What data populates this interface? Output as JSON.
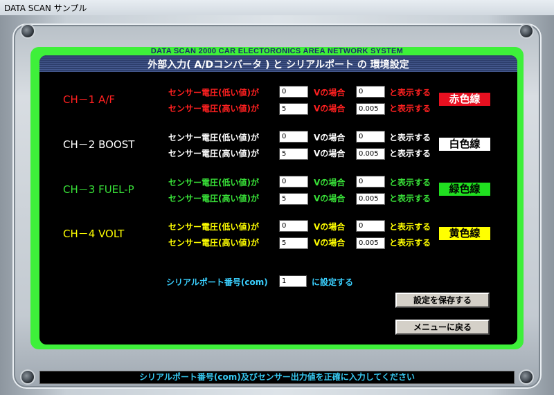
{
  "window_title": "DATA SCAN サンプル",
  "system_title": "DATA SCAN 2000  CAR ELECTORONICS  AREA  NETWORK  SYSTEM",
  "banner": "外部入力( A/Dコンバータ ) と シリアルポート の 環境設定",
  "colors": {
    "red": "#ff2020",
    "white": "#ffffff",
    "green": "#38e038",
    "yellow": "#ffff00",
    "cyan": "#3ad0ff"
  },
  "channels": [
    {
      "name": "CH－1   A/F",
      "color": "#ff2020",
      "low_label": "センサー電圧(低い値)が",
      "high_label": "センサー電圧(高い値)が",
      "v_label": "Vの場合",
      "disp_label": "と表示する",
      "low_v": "0",
      "high_v": "5",
      "low_disp": "0",
      "high_disp": "0.005",
      "wire": "赤色線",
      "wire_bg": "#e81020",
      "wire_fg": "#ffffff"
    },
    {
      "name": "CH－2   BOOST",
      "color": "#ffffff",
      "low_label": "センサー電圧(低い値)が",
      "high_label": "センサー電圧(高い値)が",
      "v_label": "Vの場合",
      "disp_label": "と表示する",
      "low_v": "0",
      "high_v": "5",
      "low_disp": "0",
      "high_disp": "0.005",
      "wire": "白色線",
      "wire_bg": "#ffffff",
      "wire_fg": "#000000"
    },
    {
      "name": "CH－3   FUEL-P",
      "color": "#38e038",
      "low_label": "センサー電圧(低い値)が",
      "high_label": "センサー電圧(高い値)が",
      "v_label": "Vの場合",
      "disp_label": "と表示する",
      "low_v": "0",
      "high_v": "5",
      "low_disp": "0",
      "high_disp": "0.005",
      "wire": "緑色線",
      "wire_bg": "#20e020",
      "wire_fg": "#000000"
    },
    {
      "name": "CH－4   VOLT",
      "color": "#ffff00",
      "low_label": "センサー電圧(低い値)が",
      "high_label": "センサー電圧(高い値)が",
      "v_label": "Vの場合",
      "disp_label": "と表示する",
      "low_v": "0",
      "high_v": "5",
      "low_disp": "0",
      "high_disp": "0.005",
      "wire": "黄色線",
      "wire_bg": "#ffff00",
      "wire_fg": "#000000"
    }
  ],
  "serial": {
    "label": "シリアルポート番号(com)",
    "value": "1",
    "suffix": "に設定する"
  },
  "buttons": {
    "save": "設定を保存する",
    "menu": "メニューに戻る"
  },
  "status": "シリアルポート番号(com)及びセンサー出力値を正確に入力してください"
}
